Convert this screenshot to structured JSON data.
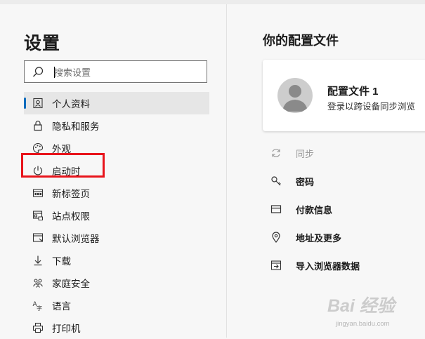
{
  "settings": {
    "title": "设置",
    "search_placeholder": "搜索设置"
  },
  "nav": [
    {
      "label": "个人资料",
      "icon": "profile-icon",
      "active": true
    },
    {
      "label": "隐私和服务",
      "icon": "lock-icon"
    },
    {
      "label": "外观",
      "icon": "palette-icon"
    },
    {
      "label": "启动时",
      "icon": "power-icon",
      "highlighted": true
    },
    {
      "label": "新标签页",
      "icon": "new-tab-icon"
    },
    {
      "label": "站点权限",
      "icon": "site-permissions-icon"
    },
    {
      "label": "默认浏览器",
      "icon": "default-browser-icon"
    },
    {
      "label": "下载",
      "icon": "download-icon"
    },
    {
      "label": "家庭安全",
      "icon": "family-icon"
    },
    {
      "label": "语言",
      "icon": "language-icon"
    },
    {
      "label": "打印机",
      "icon": "printer-icon"
    }
  ],
  "profile": {
    "heading": "你的配置文件",
    "card_name": "配置文件 1",
    "card_subtitle": "登录以跨设备同步浏览"
  },
  "profile_items": [
    {
      "label": "同步",
      "icon": "sync-icon",
      "disabled": true
    },
    {
      "label": "密码",
      "icon": "key-icon"
    },
    {
      "label": "付款信息",
      "icon": "card-icon"
    },
    {
      "label": "地址及更多",
      "icon": "location-icon"
    },
    {
      "label": "导入浏览器数据",
      "icon": "import-icon"
    }
  ],
  "watermark": {
    "text": "Bai 经验",
    "url": "jingyan.baidu.com"
  },
  "colors": {
    "accent": "#0f6cbd",
    "highlight_box": "#e8141b"
  }
}
